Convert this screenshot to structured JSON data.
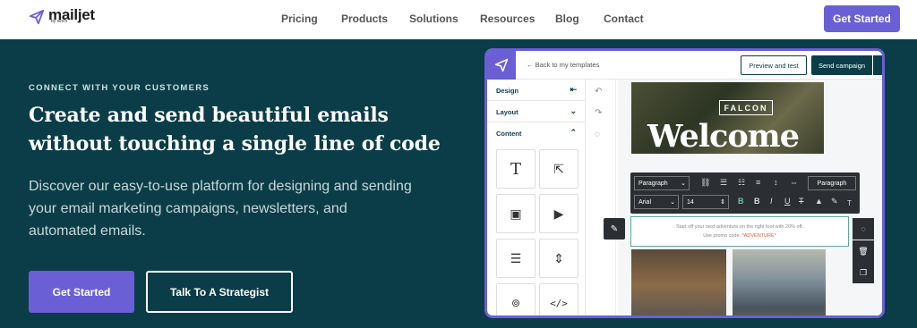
{
  "header": {
    "logo_text": "mailjet",
    "logo_sub": "by sinch",
    "nav": [
      "Pricing",
      "Products",
      "Solutions",
      "Resources",
      "Blog",
      "Contact"
    ],
    "cta": "Get Started"
  },
  "hero": {
    "eyebrow": "CONNECT WITH YOUR CUSTOMERS",
    "headline": "Create and send beautiful emails without touching a single line of code",
    "description": "Discover our easy-to-use platform for designing and sending your email marketing campaigns, newsletters, and automated emails.",
    "primary_cta": "Get Started",
    "secondary_cta": "Talk To A Strategist"
  },
  "editor": {
    "back_link": "← Back to my templates",
    "preview_button": "Preview and test",
    "send_button": "Send campaign",
    "sidebar": {
      "design": "Design",
      "layout": "Layout",
      "content": "Content"
    },
    "email": {
      "brand": "FALCON",
      "heading": "Welcome",
      "line1": "Start off your next adventure on the right foot with 20% off.",
      "line2_prefix": "Use promo code:",
      "promo_code": "*ADVENTURE*"
    },
    "toolbar": {
      "block_style": "Paragraph",
      "font": "Arial",
      "size": "14",
      "style_button": "Paragraph"
    }
  },
  "colors": {
    "accent": "#6b5fd6",
    "background": "#0b3d48"
  }
}
